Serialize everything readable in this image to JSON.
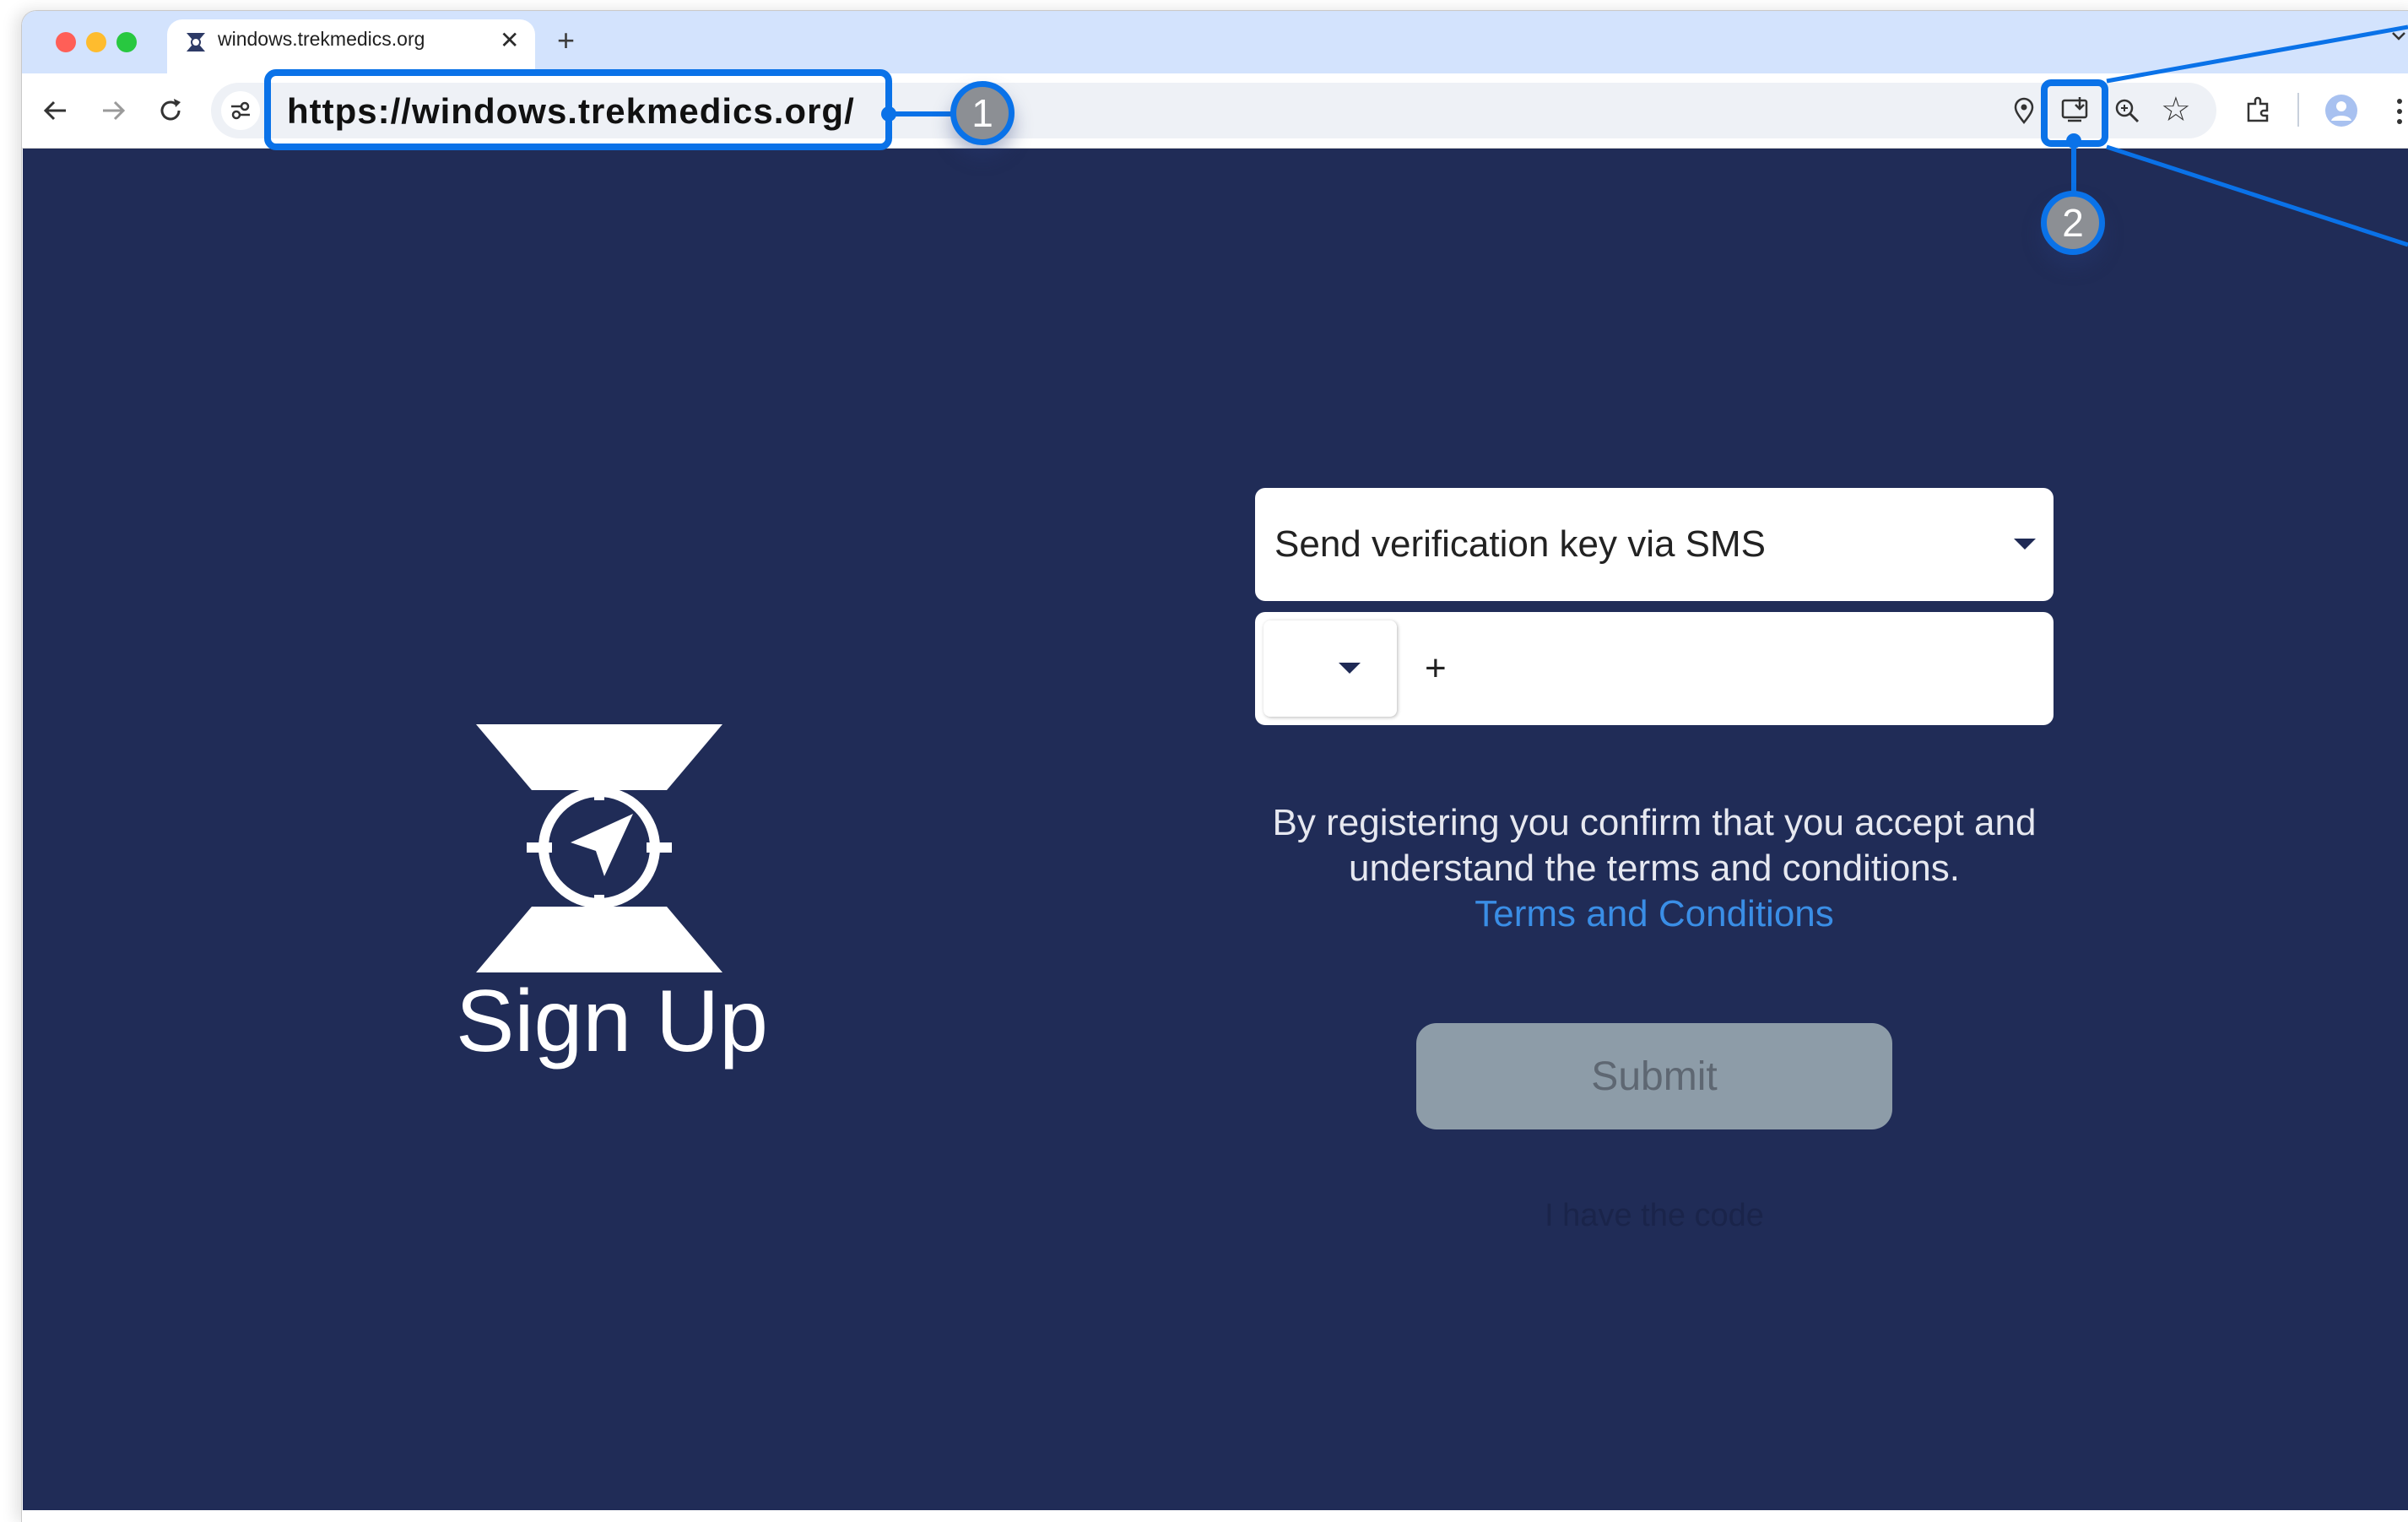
{
  "browser": {
    "traffic_lights": {
      "close": "#ff5f57",
      "minimize": "#febc2e",
      "maximize": "#28c840"
    },
    "tab": {
      "title": "windows.trekmedics.org",
      "favicon": "trek-medics-logo-icon"
    },
    "url": "https://windows.trekmedics.org/",
    "toolbar_icons": [
      "back-icon",
      "forward-icon",
      "reload-icon",
      "site-info-icon",
      "location-icon",
      "install-app-icon",
      "zoom-icon",
      "bookmark-star-icon",
      "extensions-icon",
      "profile-icon",
      "more-menu-icon"
    ],
    "accent_color": "#0a72e8"
  },
  "annotations": {
    "callout_1": "1",
    "callout_2": "2"
  },
  "page": {
    "background": "#202c57",
    "logo": "trek-medics-compass-logo",
    "title": "Sign Up",
    "verification_method": "Send verification key via SMS",
    "phone_prefix": "+",
    "terms_text": "By registering you confirm that you accept and understand the terms and conditions.",
    "terms_link": "Terms and Conditions",
    "submit_label": "Submit",
    "have_code_link": "I have the code"
  }
}
